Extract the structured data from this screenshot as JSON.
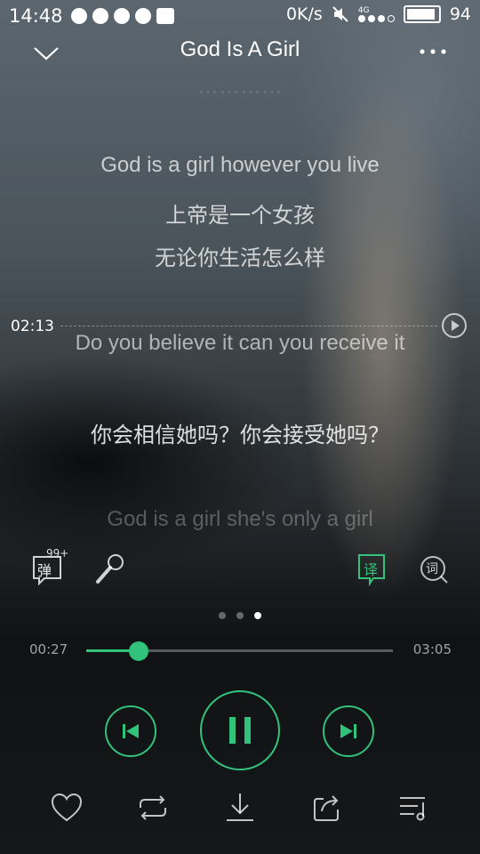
{
  "status_bar": {
    "time": "14:48",
    "speed": "0K/s",
    "network": "4G",
    "battery": "94"
  },
  "header": {
    "title": "God Is A Girl"
  },
  "lyrics": {
    "ghost_line": "…………",
    "line1": "God is a girl  however you live",
    "line2": "上帝是一个女孩",
    "line3": "无论你生活怎么样",
    "line4": "Do you believe it  can you receive it",
    "line5": "你会相信她吗？你会接受她吗？",
    "line6": "God is a girl  she's only a girl"
  },
  "seek_preview": {
    "time": "02:13"
  },
  "tools": {
    "comments_badge": "99+",
    "comments_label": "弹",
    "translate_label": "译",
    "lyrics_label": "词"
  },
  "pager": {
    "pages": 3,
    "active": 3
  },
  "progress": {
    "elapsed": "00:27",
    "total": "03:05",
    "fraction": 0.17
  },
  "colors": {
    "accent": "#31c27c"
  }
}
